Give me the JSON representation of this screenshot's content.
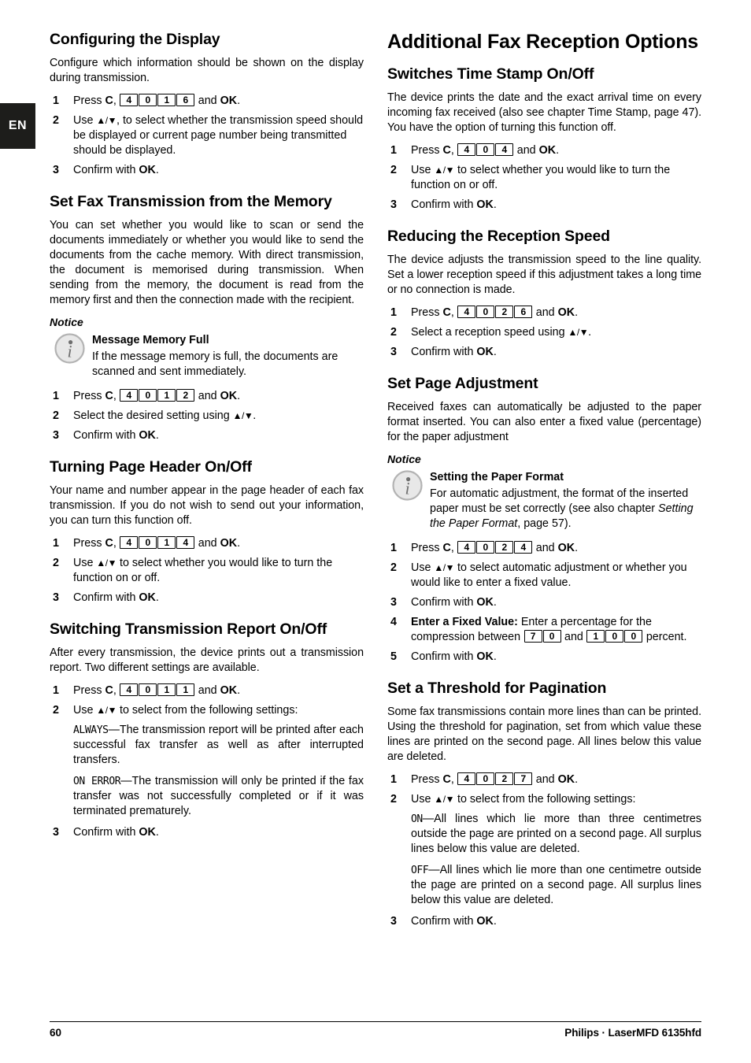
{
  "language_tab": "EN",
  "footer": {
    "page_number": "60",
    "brand": "Philips · LaserMFD 6135hfd"
  },
  "left_column": {
    "section_configuring_display": {
      "heading": "Configuring the Display",
      "intro": "Configure which information should be shown on the display during transmission.",
      "steps": [
        {
          "num": "1",
          "prefix": "Press ",
          "key_c": "C",
          "comma": ", ",
          "keys": [
            "4",
            "0",
            "1",
            "6"
          ],
          "suffix_and": " and ",
          "key_ok": "OK",
          "period": "."
        },
        {
          "num": "2",
          "text_before": "Use ",
          "arrows": "▲/▼",
          "text_after": ", to select whether the transmission speed should be displayed or current page number being transmitted should be displayed."
        },
        {
          "num": "3",
          "text_before": "Confirm with ",
          "key_ok": "OK",
          "period": "."
        }
      ]
    },
    "section_set_fax_transmission": {
      "heading": "Set Fax Transmission from the Memory",
      "intro": "You can set whether you would like to scan or send the documents immediately or whether you would like to send the documents from the cache memory. With direct transmission, the document is memorised during transmission. When sending from the memory, the document is read from the memory first and then the connection made with the recipient.",
      "notice_label": "Notice",
      "notice": {
        "icon": "info-icon",
        "title": "Message Memory Full",
        "text": "If the message memory is full, the documents are scanned and sent immediately."
      },
      "steps": [
        {
          "num": "1",
          "prefix": "Press ",
          "key_c": "C",
          "comma": ", ",
          "keys": [
            "4",
            "0",
            "1",
            "2"
          ],
          "suffix_and": " and ",
          "key_ok": "OK",
          "period": "."
        },
        {
          "num": "2",
          "text_before": "Select the desired setting using ",
          "arrows": "▲/▼",
          "text_after": "."
        },
        {
          "num": "3",
          "text_before": "Confirm with ",
          "key_ok": "OK",
          "period": "."
        }
      ]
    },
    "section_page_header": {
      "heading": "Turning Page Header On/Off",
      "intro": "Your name and number appear in the page header of each fax transmission. If you do not wish to send out your information, you can turn this function off.",
      "steps": [
        {
          "num": "1",
          "prefix": "Press ",
          "key_c": "C",
          "comma": ", ",
          "keys": [
            "4",
            "0",
            "1",
            "4"
          ],
          "suffix_and": " and ",
          "key_ok": "OK",
          "period": "."
        },
        {
          "num": "2",
          "text_before": "Use ",
          "arrows": "▲/▼",
          "text_after": " to select whether you would like to turn the function on or off."
        },
        {
          "num": "3",
          "text_before": "Confirm with ",
          "key_ok": "OK",
          "period": "."
        }
      ]
    },
    "section_transmission_report": {
      "heading": "Switching Transmission Report On/Off",
      "intro": "After every transmission, the device prints out a transmission report. Two different settings are available.",
      "steps": [
        {
          "num": "1",
          "prefix": "Press ",
          "key_c": "C",
          "comma": ", ",
          "keys": [
            "4",
            "0",
            "1",
            "1"
          ],
          "suffix_and": " and ",
          "key_ok": "OK",
          "period": "."
        },
        {
          "num": "2",
          "text_before": "Use ",
          "arrows": "▲/▼",
          "text_after": " to select from the following settings:"
        }
      ],
      "option_always": {
        "label": "ALWAYS",
        "text": "—The transmission report will be printed after each successful fax transfer as well as after interrupted transfers."
      },
      "option_on_error": {
        "label": "ON ERROR",
        "text": "—The transmission will only be printed if the fax transfer was not successfully completed or if it was terminated prematurely."
      },
      "final_step": {
        "num": "3",
        "text_before": "Confirm with ",
        "key_ok": "OK",
        "period": "."
      }
    }
  },
  "right_column": {
    "chapter_heading": "Additional Fax Reception Options",
    "section_time_stamp": {
      "heading": "Switches Time Stamp On/Off",
      "intro": "The device prints the date and the exact arrival time on every incoming fax received (also see chapter Time Stamp, page 47). You have the option of turning this function off.",
      "steps": [
        {
          "num": "1",
          "prefix": "Press ",
          "key_c": "C",
          "comma": ", ",
          "keys": [
            "4",
            "0",
            "4"
          ],
          "suffix_and": " and ",
          "key_ok": "OK",
          "period": "."
        },
        {
          "num": "2",
          "text_before": "Use ",
          "arrows": "▲/▼",
          "text_after": " to select whether you would like to turn the function on or off."
        },
        {
          "num": "3",
          "text_before": "Confirm with ",
          "key_ok": "OK",
          "period": "."
        }
      ]
    },
    "section_reception_speed": {
      "heading": "Reducing the Reception Speed",
      "intro": "The device adjusts the transmission speed to the line quality. Set a lower reception speed if this adjustment takes a long time or no connection is made.",
      "steps": [
        {
          "num": "1",
          "prefix": "Press ",
          "key_c": "C",
          "comma": ", ",
          "keys": [
            "4",
            "0",
            "2",
            "6"
          ],
          "suffix_and": " and ",
          "key_ok": "OK",
          "period": "."
        },
        {
          "num": "2",
          "text_before": "Select a reception speed using ",
          "arrows": "▲/▼",
          "text_after": "."
        },
        {
          "num": "3",
          "text_before": "Confirm with ",
          "key_ok": "OK",
          "period": "."
        }
      ]
    },
    "section_page_adjustment": {
      "heading": "Set Page Adjustment",
      "intro": "Received faxes can automatically be adjusted to the paper format inserted. You can also enter a fixed value (percentage) for the paper adjustment",
      "notice_label": "Notice",
      "notice": {
        "icon": "info-icon",
        "title": "Setting the Paper Format",
        "text_before": "For automatic adjustment, the format of the inserted paper must be set correctly (see also chapter ",
        "italic_ref": "Setting the Paper Format",
        "text_after": ", page 57)."
      },
      "steps": [
        {
          "num": "1",
          "prefix": "Press ",
          "key_c": "C",
          "comma": ", ",
          "keys": [
            "4",
            "0",
            "2",
            "4"
          ],
          "suffix_and": " and ",
          "key_ok": "OK",
          "period": "."
        },
        {
          "num": "2",
          "text_before": "Use ",
          "arrows": "▲/▼",
          "text_after": " to select automatic adjustment or whether you would like to enter a fixed value."
        },
        {
          "num": "3",
          "text_before": "Confirm with ",
          "key_ok": "OK",
          "period": "."
        }
      ],
      "step_fixed_value": {
        "num": "4",
        "bold_lead": "Enter a Fixed Value:",
        "text_before": " Enter a percentage for the compression between ",
        "keys_min": [
          "7",
          "0"
        ],
        "text_mid": " and ",
        "keys_max": [
          "1",
          "0",
          "0"
        ],
        "text_after": " percent."
      },
      "step_final": {
        "num": "5",
        "text_before": "Confirm with ",
        "key_ok": "OK",
        "period": "."
      }
    },
    "section_pagination_threshold": {
      "heading": "Set a Threshold for Pagination",
      "intro": "Some fax transmissions contain more lines than can be printed. Using the threshold for pagination, set from which value these lines are printed on the second page. All lines below this value are deleted.",
      "steps": [
        {
          "num": "1",
          "prefix": "Press ",
          "key_c": "C",
          "comma": ", ",
          "keys": [
            "4",
            "0",
            "2",
            "7"
          ],
          "suffix_and": " and ",
          "key_ok": "OK",
          "period": "."
        },
        {
          "num": "2",
          "text_before": "Use ",
          "arrows": "▲/▼",
          "text_after": " to select from the following settings:"
        }
      ],
      "option_on": {
        "label": "ON",
        "text": "—All lines which lie more than three centimetres outside the page are printed on a second page. All surplus lines below this value are deleted."
      },
      "option_off": {
        "label": "OFF",
        "text": "—All lines which lie more than one centimetre outside the page are printed on a second page. All surplus lines below this value are deleted."
      },
      "final_step": {
        "num": "3",
        "text_before": "Confirm with ",
        "key_ok": "OK",
        "period": "."
      }
    }
  }
}
